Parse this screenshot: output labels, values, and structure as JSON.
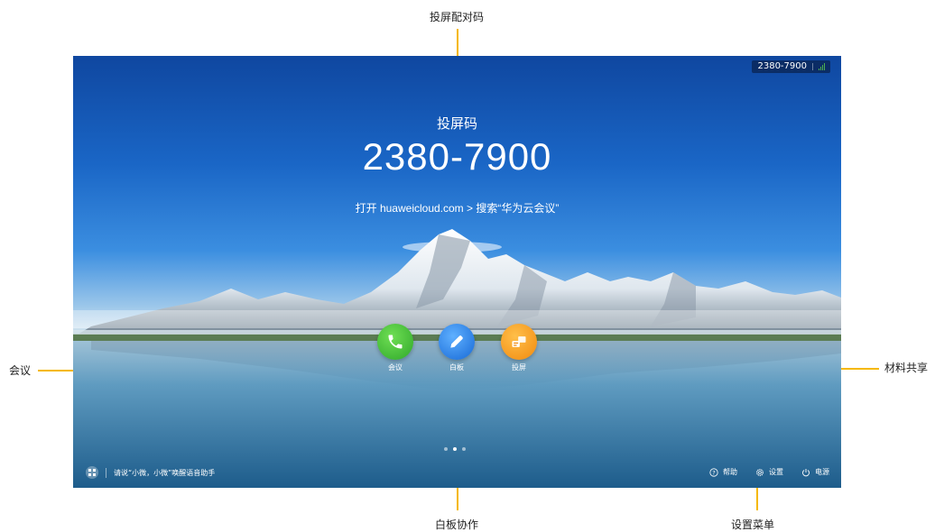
{
  "screen": {
    "top_code": "2380-7900",
    "title_small": "投屏码",
    "big_code": "2380-7900",
    "hint": "打开 huaweicloud.com > 搜索“华为云会议”",
    "apps": [
      {
        "label": "会议",
        "icon": "phone-icon"
      },
      {
        "label": "白板",
        "icon": "pen-icon"
      },
      {
        "label": "投屏",
        "icon": "share-screen-icon"
      }
    ],
    "page_dots": 3,
    "voice_hint": "请说“小微，小微”唤醒语音助手",
    "bottom_menu": [
      {
        "label": "帮助",
        "icon": "help-icon"
      },
      {
        "label": "设置",
        "icon": "gear-icon"
      },
      {
        "label": "电源",
        "icon": "power-icon"
      }
    ]
  },
  "annotations": {
    "top": "投屏配对码",
    "left": "会议",
    "right": "材料共享",
    "bottom_center": "白板协作",
    "bottom_right": "设置菜单"
  },
  "colors": {
    "callout": "#f5b800",
    "meeting": "#3ec234",
    "whiteboard": "#1f7ae8",
    "share": "#f59a1a"
  }
}
